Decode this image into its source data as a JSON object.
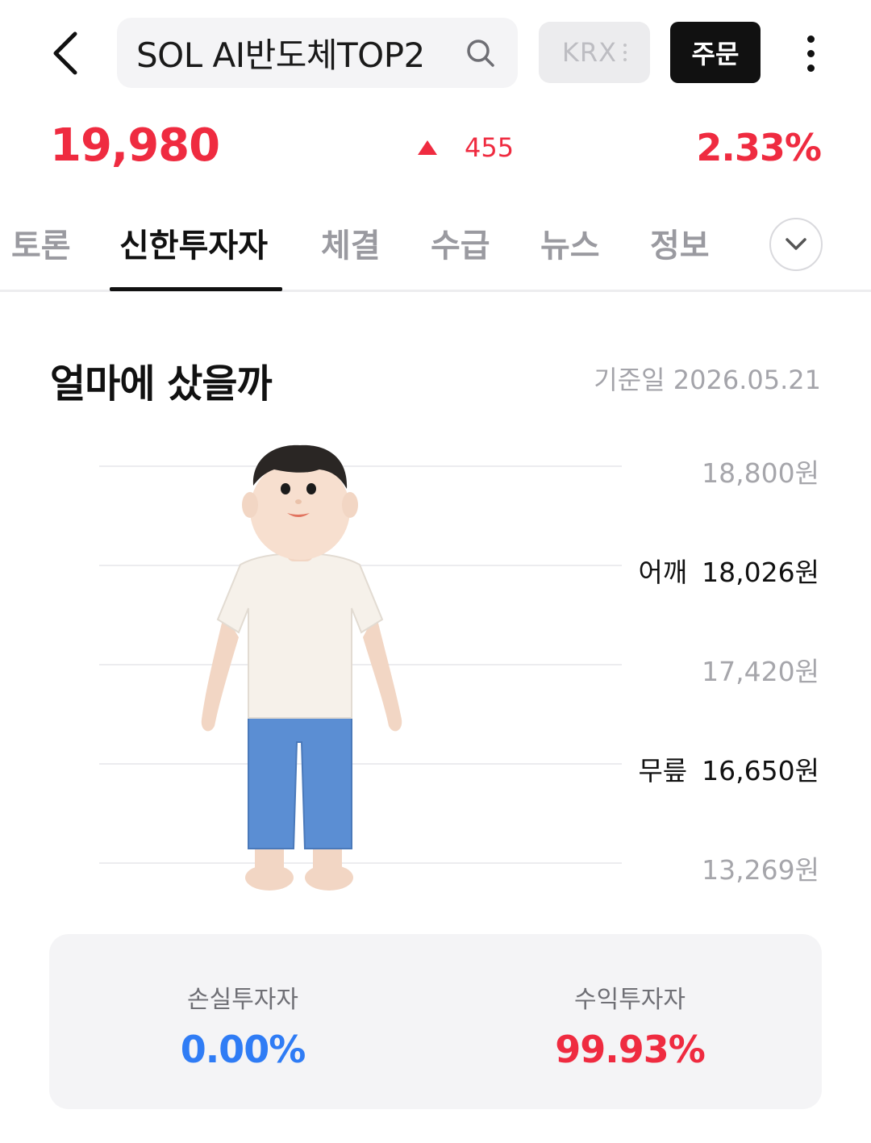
{
  "header": {
    "search_text": "SOL AI반도체TOP2",
    "exchange_label": "KRX",
    "order_label": "주문"
  },
  "quote": {
    "price": "19,980",
    "change": "455",
    "change_pct": "2.33%",
    "direction": "up"
  },
  "tabs": [
    {
      "label": "토론",
      "active": false
    },
    {
      "label": "신한투자자",
      "active": true
    },
    {
      "label": "체결",
      "active": false
    },
    {
      "label": "수급",
      "active": false
    },
    {
      "label": "뉴스",
      "active": false
    },
    {
      "label": "정보",
      "active": false
    }
  ],
  "section": {
    "title": "얼마에 샀을까",
    "base_date": "기준일 2026.05.21"
  },
  "levels": [
    {
      "tag": "",
      "value": "18,800원"
    },
    {
      "tag": "어깨",
      "value": "18,026원"
    },
    {
      "tag": "",
      "value": "17,420원"
    },
    {
      "tag": "무릎",
      "value": "16,650원"
    },
    {
      "tag": "",
      "value": "13,269원"
    }
  ],
  "summary": {
    "loss_label": "손실투자자",
    "loss_value": "0.00%",
    "profit_label": "수익투자자",
    "profit_value": "99.93%"
  },
  "colors": {
    "up": "#ef2b40",
    "loss_blue": "#2f7cf5",
    "muted": "#a4a4aa"
  },
  "icons": [
    "back-arrow-icon",
    "search-icon",
    "more-vertical-icon",
    "chevron-down-icon",
    "up-triangle-icon"
  ]
}
